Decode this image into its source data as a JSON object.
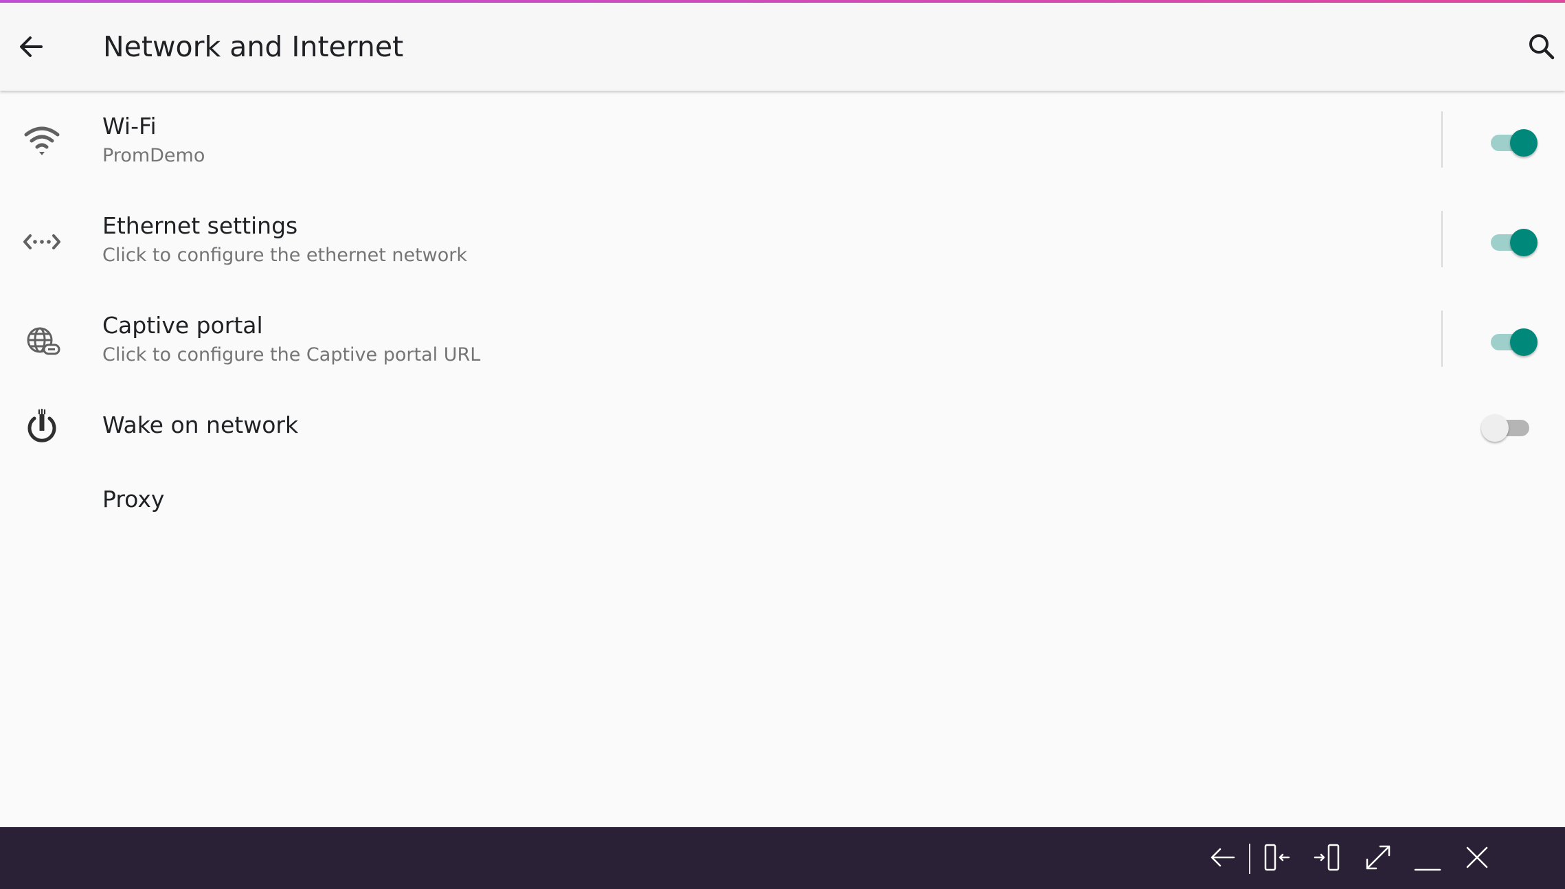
{
  "colors": {
    "accent_gradient_start": "#c24fd6",
    "accent_gradient_end": "#e0479e",
    "toggle_on": "#00897b",
    "taskbar_bg": "#2b2136"
  },
  "header": {
    "title": "Network and Internet",
    "back_icon": "arrow-left-icon",
    "search_icon": "search-icon"
  },
  "settings": {
    "wifi": {
      "title": "Wi-Fi",
      "subtitle": "PromDemo",
      "icon": "wifi-icon",
      "enabled": true
    },
    "ethernet": {
      "title": "Ethernet settings",
      "subtitle": "Click to configure the ethernet network",
      "icon": "ethernet-icon",
      "enabled": true
    },
    "captive": {
      "title": "Captive portal",
      "subtitle": "Click to configure the Captive portal URL",
      "icon": "globe-link-icon",
      "enabled": true
    },
    "wake": {
      "title": "Wake on network",
      "icon": "power-network-icon",
      "enabled": false
    },
    "proxy": {
      "title": "Proxy"
    }
  },
  "taskbar": {
    "buttons": [
      "back-icon",
      "dock-left-icon",
      "dock-right-icon",
      "maximize-icon",
      "minimize-icon",
      "close-icon"
    ]
  }
}
